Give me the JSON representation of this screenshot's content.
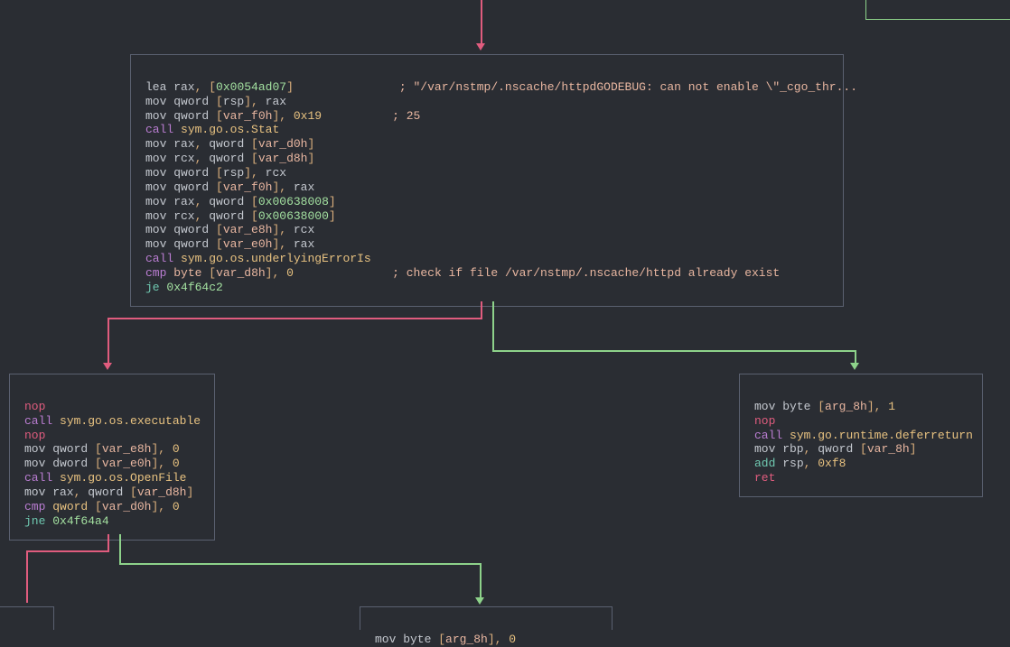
{
  "block1": {
    "l0": "lea rax, [0x0054ad07]               ; \"/var/nstmp/.nscache/httpdGODEBUG: can not enable \\\"_cgo_thr...",
    "l1": "mov qword [rsp], rax",
    "l2": "mov qword [var_f0h], 0x19          ; 25",
    "l3": "call sym.go.os.Stat",
    "l4": "mov rax, qword [var_d0h]",
    "l5": "mov rcx, qword [var_d8h]",
    "l6": "mov qword [rsp], rcx",
    "l7": "mov qword [var_f0h], rax",
    "l8": "mov rax, qword [0x00638008]",
    "l9": "mov rcx, qword [0x00638000]",
    "l10": "mov qword [var_e8h], rcx",
    "l11": "mov qword [var_e0h], rax",
    "l12": "call sym.go.os.underlyingErrorIs",
    "l13": "cmp byte [var_d8h], 0              ; check if file /var/nstmp/.nscache/httpd already exist",
    "l14": "je 0x4f64c2"
  },
  "block2": {
    "l0": "nop",
    "l1": "call sym.go.os.executable",
    "l2": "nop",
    "l3": "mov qword [var_e8h], 0",
    "l4": "mov dword [var_e0h], 0",
    "l5": "call sym.go.os.OpenFile",
    "l6": "mov rax, qword [var_d8h]",
    "l7": "cmp qword [var_d0h], 0",
    "l8": "jne 0x4f64a4"
  },
  "block3": {
    "l0": "mov byte [arg_8h], 1",
    "l1": "nop",
    "l2": "call sym.go.runtime.deferreturn",
    "l3": "mov rbp, qword [var_8h]",
    "l4": "add rsp, 0xf8",
    "l5": "ret"
  },
  "block4": {
    "l0": "mov byte [arg_8h], 0"
  }
}
